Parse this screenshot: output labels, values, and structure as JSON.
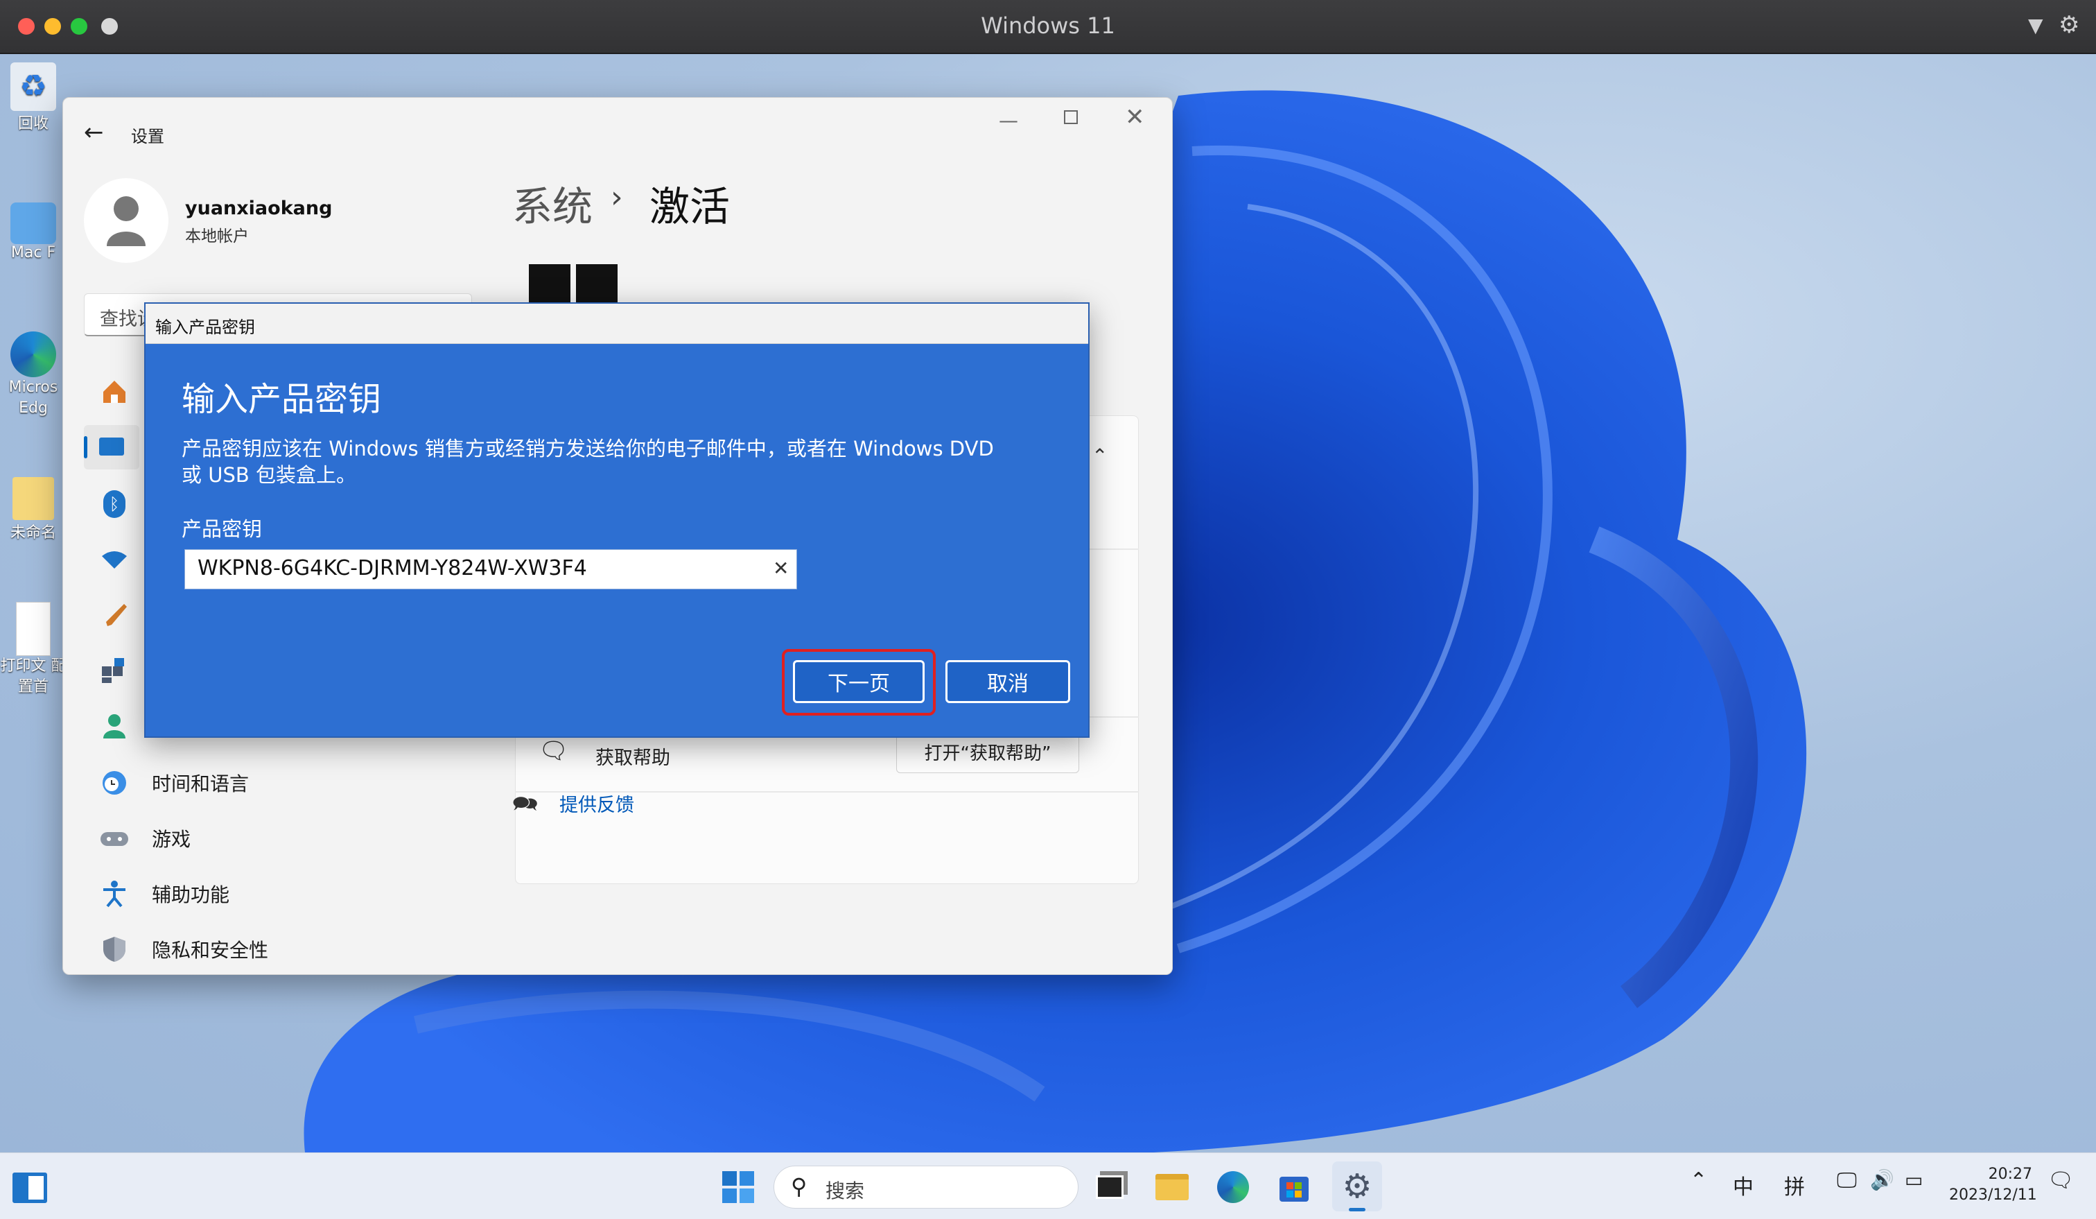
{
  "mac": {
    "title": "Windows 11"
  },
  "desktop": {
    "icons": [
      {
        "label": "回收"
      },
      {
        "label": "Mac F"
      },
      {
        "label": "Micros Edg"
      },
      {
        "label": "未命名"
      },
      {
        "label": "打印文 配置首"
      }
    ]
  },
  "settings": {
    "title": "设置",
    "user": {
      "name": "yuanxiaokang",
      "type": "本地帐户"
    },
    "search": {
      "placeholder": "查找设"
    },
    "breadcrumb": {
      "parent": "系统",
      "separator": "›",
      "current": "激活"
    },
    "nav": {
      "time_language": "时间和语言",
      "gaming": "游戏",
      "accessibility": "辅助功能",
      "privacy": "隐私和安全性"
    },
    "help_row": {
      "label": "获取帮助",
      "button": "打开“获取帮助”"
    },
    "feedback": "提供反馈"
  },
  "dialog": {
    "window_title": "输入产品密钥",
    "heading": "输入产品密钥",
    "description_line1": "产品密钥应该在 Windows 销售方或经销方发送给你的电子邮件中，或者在 Windows DVD",
    "description_line2": "或 USB 包装盒上。",
    "field_label": "产品密钥",
    "field_value": "WKPN8-6G4KC-DJRMM-Y824W-XW3F4",
    "next_button": "下一页",
    "cancel_button": "取消"
  },
  "taskbar": {
    "search": "搜索",
    "ime_lang": "中",
    "ime_mode": "拼",
    "time": "20:27",
    "date": "2023/12/11"
  },
  "colors": {
    "dialog_blue": "#2d6fd2",
    "highlight_red": "#e02020",
    "accent": "#0067c0"
  }
}
